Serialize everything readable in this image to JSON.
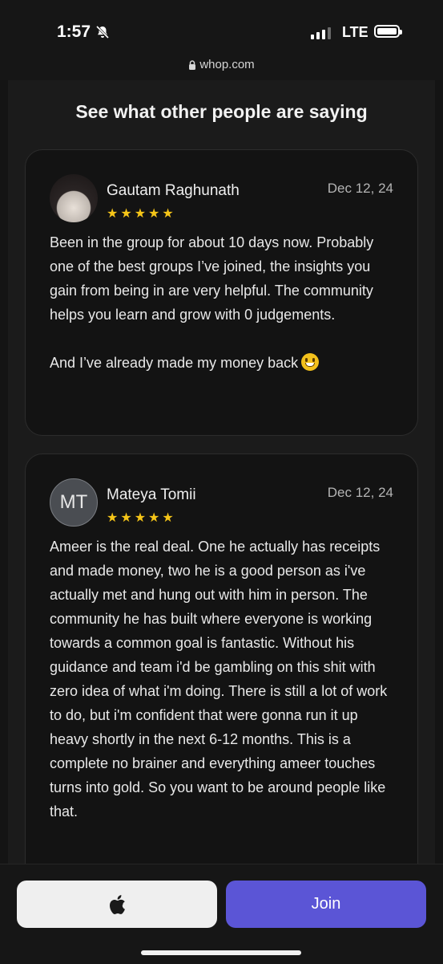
{
  "status": {
    "time": "1:57",
    "carrier": "LTE",
    "url": "whop.com",
    "signal_bars": 3,
    "signal_bars_total": 4
  },
  "heading": "See what other people are saying",
  "reviews": [
    {
      "name": "Gautam Raghunath",
      "date": "Dec 12, 24",
      "stars": "★★★★★",
      "rating": 5,
      "avatar": "profile-photo",
      "text": "Been in the group for about 10 days now. Probably one of the best groups I’ve joined, the insights you gain from being in are very helpful. The community helps you learn and grow with 0 judgements.\n\nAnd I’ve already made my money back",
      "emoji": "grinning-face"
    },
    {
      "name": "Mateya Tomii",
      "initials": "MT",
      "date": "Dec 12, 24",
      "stars": "★★★★★",
      "rating": 5,
      "text": "Ameer is the real deal. One he actually has receipts and made money, two he is a good person as i've actually met and hung out with him in person. The community he has built where everyone is working towards a common goal is fantastic. Without his guidance and team i'd be gambling on this shit with zero idea of what i'm doing. There is still a lot of work to do, but i'm confident that were gonna run it up heavy shortly in the next 6-12 months. This is a complete no brainer and everything ameer touches turns into gold. So you want to be around people like that."
    }
  ],
  "buttons": {
    "apple_icon": "apple-logo-icon",
    "join": "Join"
  },
  "colors": {
    "background": "#141414",
    "accent": "#5b55d6",
    "star": "#f5c518"
  }
}
